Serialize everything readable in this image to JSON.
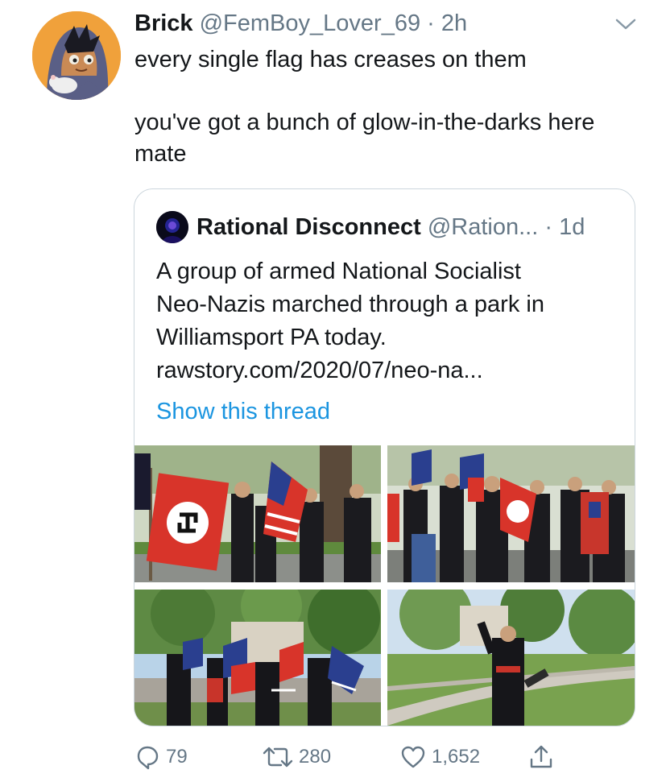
{
  "tweet": {
    "name": "Brick",
    "handle": "@FemBoy_Lover_69",
    "separator": "·",
    "time": "2h",
    "avatar_icon": "cartoon-character-avatar",
    "text_paragraphs": [
      "every single flag has creases on them",
      "you've got a bunch of glow-in-the-darks here mate"
    ]
  },
  "quoted": {
    "name": "Rational Disconnect",
    "handle": "@Ration...",
    "separator": "·",
    "time": "1d",
    "text_lines": [
      "A group of armed National Socialist",
      "Neo-Nazis marched through a park in",
      "Williamsport PA today.",
      "rawstory.com/2020/07/neo-na..."
    ],
    "show_thread": "Show this thread",
    "photos": [
      "march-photo-1",
      "march-photo-2",
      "march-photo-3",
      "march-photo-4"
    ]
  },
  "actions": {
    "reply_count": "79",
    "retweet_count": "280",
    "like_count": "1,652"
  },
  "colors": {
    "text": "#14171a",
    "secondary": "#657786",
    "link": "#1b95e0",
    "border": "#ccd6dd",
    "avatar_bg": "#f0a13b"
  }
}
